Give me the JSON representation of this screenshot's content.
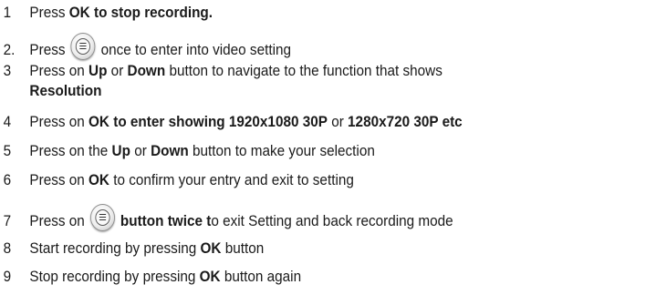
{
  "steps": [
    {
      "num": "1",
      "parts": [
        {
          "t": "Press "
        },
        {
          "t": "OK to stop recording.",
          "b": true
        }
      ]
    },
    {
      "num": "2.",
      "parts": [
        {
          "t": "Press "
        },
        {
          "icon": "menu-button-icon"
        },
        {
          "t": " once to enter into video setting"
        }
      ]
    },
    {
      "num": "3",
      "parts": [
        {
          "t": "Press on "
        },
        {
          "t": "Up",
          "b": true
        },
        {
          "t": " or "
        },
        {
          "t": "Down",
          "b": true
        },
        {
          "t": " button to navigate to the function that shows"
        }
      ],
      "cont": [
        {
          "t": "Resolution",
          "b": true
        }
      ]
    },
    {
      "num": "4",
      "parts": [
        {
          "t": "Press on "
        },
        {
          "t": "OK to enter showing 1920x1080 30P",
          "b": true
        },
        {
          "t": " or "
        },
        {
          "t": "1280x720 30P etc",
          "b": true
        }
      ]
    },
    {
      "num": "5",
      "parts": [
        {
          "t": "Press on the "
        },
        {
          "t": "Up",
          "b": true
        },
        {
          "t": " or "
        },
        {
          "t": "Down",
          "b": true
        },
        {
          "t": " button to make your selection"
        }
      ]
    },
    {
      "num": "6",
      "parts": [
        {
          "t": "Press on "
        },
        {
          "t": "OK",
          "b": true
        },
        {
          "t": " to confirm your entry and exit to setting"
        }
      ]
    },
    {
      "num": "7",
      "parts": [
        {
          "t": "Press on "
        },
        {
          "icon": "menu-button-icon"
        },
        {
          "t": " "
        },
        {
          "t": "button twice t",
          "b": true
        },
        {
          "t": "o exit Setting and back recording mode"
        }
      ]
    },
    {
      "num": "8",
      "parts": [
        {
          "t": "Start recording by pressing "
        },
        {
          "t": "OK",
          "b": true
        },
        {
          "t": " button"
        }
      ]
    },
    {
      "num": "9",
      "parts": [
        {
          "t": "Stop recording by pressing "
        },
        {
          "t": "OK",
          "b": true
        },
        {
          "t": " button again"
        }
      ]
    }
  ]
}
